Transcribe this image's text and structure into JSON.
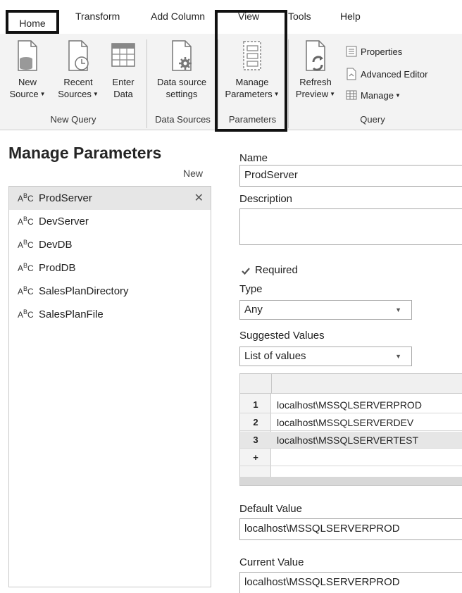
{
  "ribbon_tabs": [
    "Home",
    "Transform",
    "Add Column",
    "View",
    "Tools",
    "Help"
  ],
  "ribbon": {
    "new_source": [
      "New",
      "Source"
    ],
    "recent_sources": [
      "Recent",
      "Sources"
    ],
    "enter_data": [
      "Enter",
      "Data"
    ],
    "data_source_settings": [
      "Data source",
      "settings"
    ],
    "manage_parameters": [
      "Manage",
      "Parameters"
    ],
    "refresh_preview": [
      "Refresh",
      "Preview"
    ],
    "properties": "Properties",
    "advanced_editor": "Advanced Editor",
    "manage": "Manage",
    "groups": {
      "new_query": "New Query",
      "data_sources": "Data Sources",
      "parameters": "Parameters",
      "query": "Query"
    }
  },
  "panel": {
    "title": "Manage Parameters",
    "new_label": "New",
    "type_icon": "A B C",
    "parameters": [
      "ProdServer",
      "DevServer",
      "DevDB",
      "ProdDB",
      "SalesPlanDirectory",
      "SalesPlanFile"
    ],
    "selected_index": 0
  },
  "form": {
    "name_label": "Name",
    "name_value": "ProdServer",
    "description_label": "Description",
    "description_value": "",
    "required_label": "Required",
    "required_checked": true,
    "type_label": "Type",
    "type_value": "Any",
    "suggested_label": "Suggested Values",
    "suggested_value": "List of values",
    "values": [
      {
        "num": "1",
        "value": "localhost\\MSSQLSERVERPROD"
      },
      {
        "num": "2",
        "value": "localhost\\MSSQLSERVERDEV"
      },
      {
        "num": "3",
        "value": "localhost\\MSSQLSERVERTEST"
      },
      {
        "num": "+",
        "value": ""
      }
    ],
    "default_label": "Default Value",
    "default_value": "localhost\\MSSQLSERVERPROD",
    "current_label": "Current Value",
    "current_value": "localhost\\MSSQLSERVERPROD"
  }
}
